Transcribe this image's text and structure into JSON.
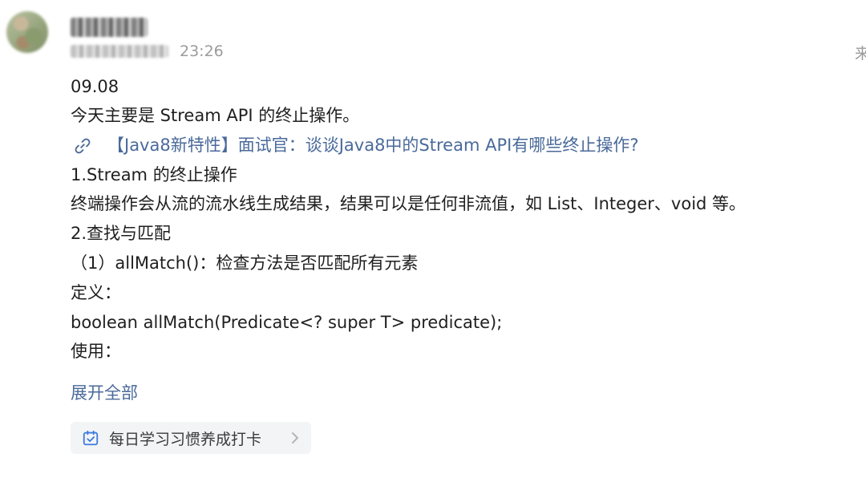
{
  "post": {
    "time": "23:26",
    "side_label": "来",
    "lines": [
      "09.08",
      "今天主要是 Stream API 的终止操作。",
      "【Java8新特性】面试官：谈谈Java8中的Stream API有哪些终止操作?",
      "1.Stream 的终止操作",
      "终端操作会从流的流水线生成结果，结果可以是任何非流值，如 List、Integer、void 等。",
      "2.查找与匹配",
      "（1）allMatch()：检查方法是否匹配所有元素",
      "定义：",
      "boolean allMatch(Predicate<? super T> predicate);",
      "使用："
    ],
    "expand_label": "展开全部",
    "tag_label": "每日学习习惯养成打卡"
  },
  "icons": {
    "link": "link-icon",
    "calendar": "calendar-check-icon",
    "chevron": "chevron-right-icon"
  },
  "colors": {
    "link": "#4a6a9a",
    "muted": "#9b9b9b",
    "tag_bg": "#f3f4f6",
    "icon_blue": "#3d7be0"
  }
}
